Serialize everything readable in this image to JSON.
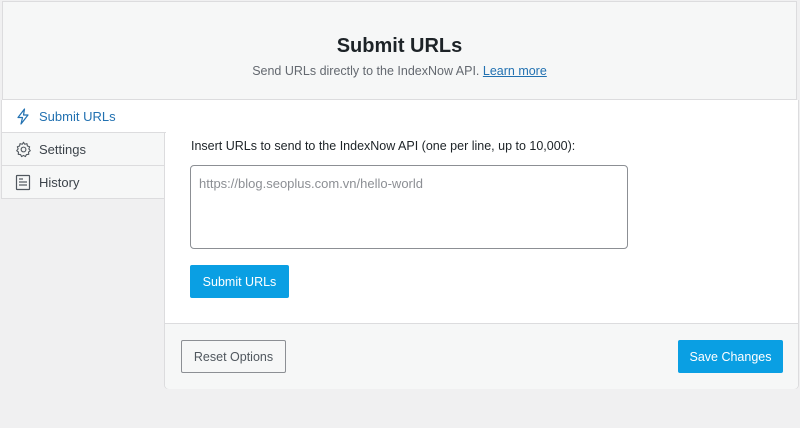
{
  "header": {
    "title": "Submit URLs",
    "subtitle": "Send URLs directly to the IndexNow API.",
    "learn_more": "Learn more"
  },
  "tabs": [
    {
      "label": "Submit URLs",
      "icon": "bolt-icon",
      "active": true
    },
    {
      "label": "Settings",
      "icon": "gear-icon",
      "active": false
    },
    {
      "label": "History",
      "icon": "document-icon",
      "active": false
    }
  ],
  "submit": {
    "instruction": "Insert URLs to send to the IndexNow API (one per line, up to 10,000):",
    "placeholder": "https://blog.seoplus.com.vn/hello-world",
    "value": "",
    "button_label": "Submit URLs"
  },
  "footer": {
    "reset_label": "Reset Options",
    "save_label": "Save Changes"
  },
  "colors": {
    "accent": "#0a9fe3",
    "link": "#2271b1",
    "background": "#f0f0f1"
  }
}
